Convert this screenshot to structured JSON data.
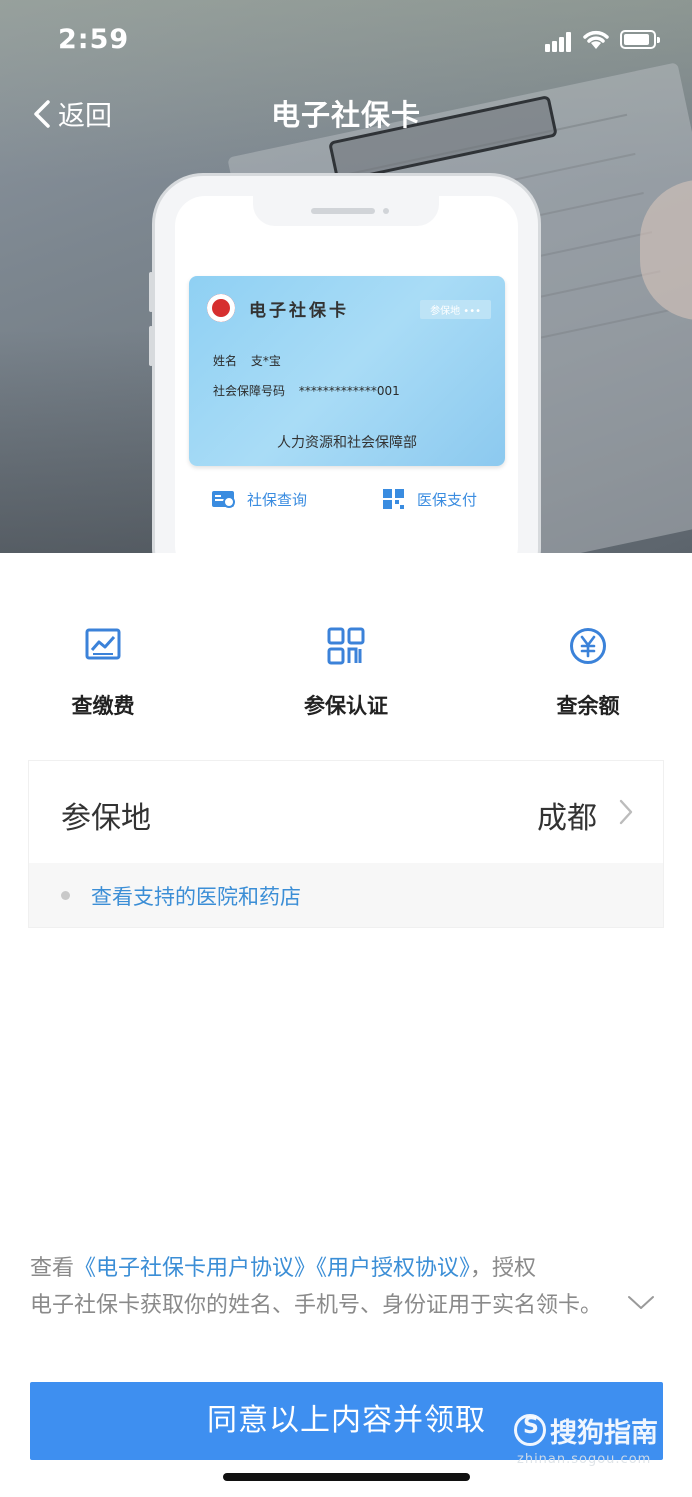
{
  "status_bar": {
    "time": "2:59"
  },
  "nav": {
    "back_label": "返回",
    "title": "电子社保卡"
  },
  "card_preview": {
    "card_title": "电子社保卡",
    "region_tag": "参保地 •••",
    "name_label": "姓名",
    "name_value": "支*宝",
    "number_label": "社会保障号码",
    "number_value": "*************001",
    "issuer": "人力资源和社会保障部",
    "actions": [
      {
        "label": "社保查询",
        "icon": "social-security-query-icon"
      },
      {
        "label": "医保支付",
        "icon": "qr-code-icon"
      }
    ]
  },
  "quick_actions": [
    {
      "label": "查缴费",
      "icon": "chart-icon"
    },
    {
      "label": "参保认证",
      "icon": "qr-code-icon"
    },
    {
      "label": "查余额",
      "icon": "yen-icon"
    }
  ],
  "insured_place": {
    "label": "参保地",
    "value": "成都",
    "support_link": "查看支持的医院和药店"
  },
  "agreement": {
    "prefix": "查看",
    "link_user": "《电子社保卡用户协议》",
    "link_auth": "《用户授权协议》",
    "text_1": "，授权",
    "text_2": "电子社保卡获取你的姓名、手机号、身份证用于实名领卡。"
  },
  "cta": {
    "label": "同意以上内容并领取"
  },
  "watermark": {
    "brand": "搜狗指南",
    "url": "zhinan.sogou.com"
  },
  "colors": {
    "accent": "#3e8ff0",
    "link": "#3b8ed6",
    "card": "#a9dcf6"
  }
}
